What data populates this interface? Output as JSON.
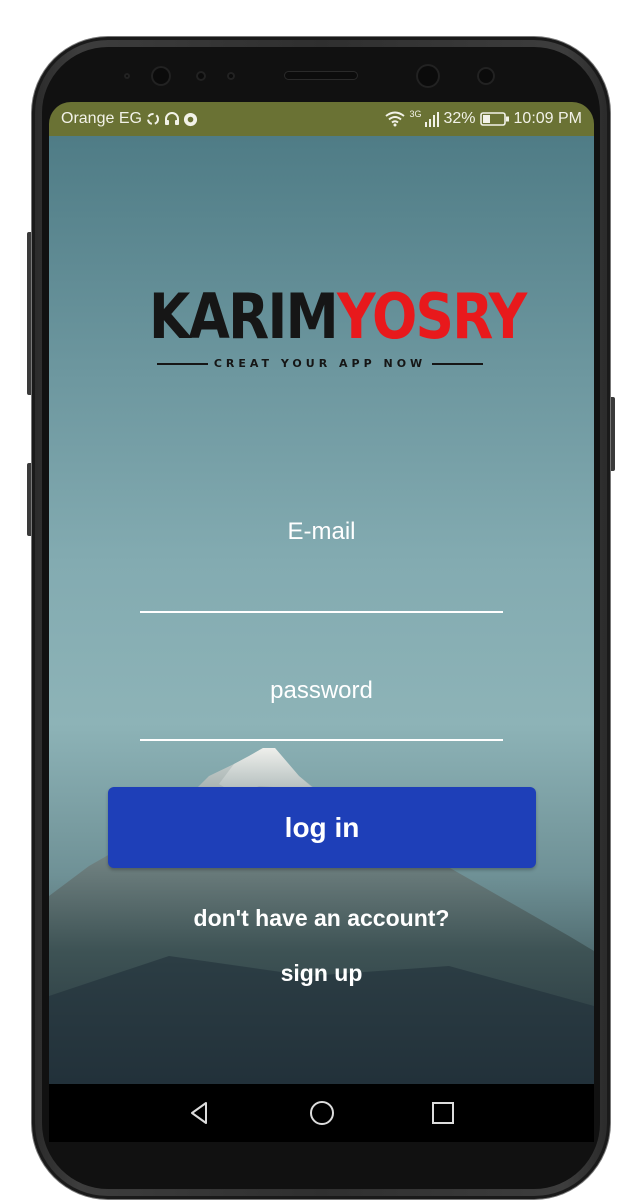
{
  "status_bar": {
    "carrier": "Orange EG",
    "network_type": "3G",
    "battery": "32%",
    "time": "10:09 PM",
    "icons": [
      "sync-icon",
      "headset-icon",
      "chrome-icon",
      "wifi-icon",
      "signal-icon",
      "battery-icon"
    ]
  },
  "logo": {
    "part1": "KARIM",
    "part2": "YOSRY",
    "tagline": "CREAT YOUR APP NOW",
    "colors": {
      "part1": "#161616",
      "part2": "#e8191c"
    }
  },
  "form": {
    "email_label": "E-mail",
    "password_label": "password",
    "login_label": "log in",
    "no_account_text": "don't have an account?",
    "signup_label": "sign up"
  },
  "nav_bar": {
    "icons": [
      "back-icon",
      "home-icon",
      "recents-icon"
    ]
  },
  "colors": {
    "status_bar": "#6a7234",
    "login_button": "#1e3fb8"
  }
}
